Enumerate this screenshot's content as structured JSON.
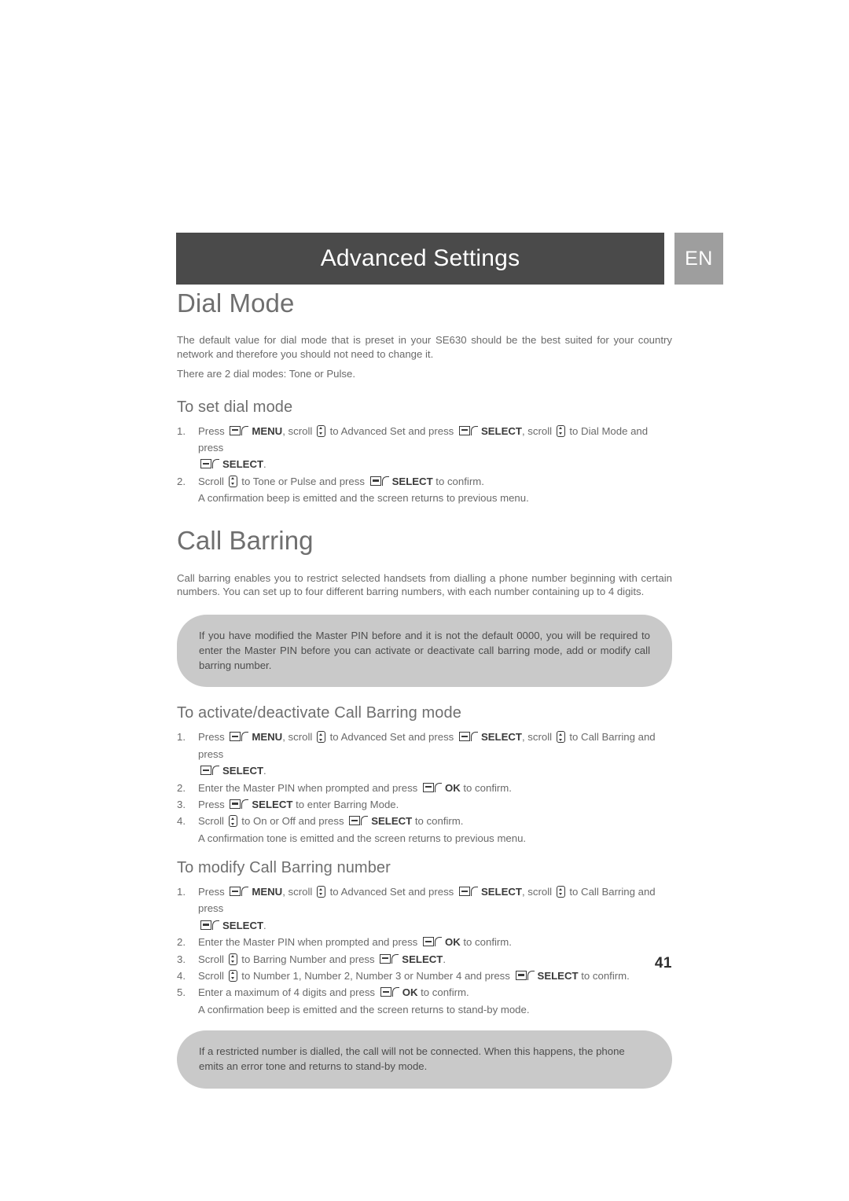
{
  "header": {
    "title": "Advanced Settings",
    "language_badge": "EN"
  },
  "sections": [
    {
      "title": "Dial Mode",
      "paragraphs": [
        "The default value for dial mode that is preset in your SE630 should be the best suited for your country network and therefore you should not need to change it.",
        "There are 2 dial modes: Tone or Pulse."
      ],
      "subsections": [
        {
          "title": "To set dial mode",
          "steps": [
            {
              "num": "1.",
              "parts": [
                {
                  "t": "text",
                  "v": "Press "
                },
                {
                  "t": "softkey-icon"
                },
                {
                  "t": "bold",
                  "v": "MENU"
                },
                {
                  "t": "text",
                  "v": ", scroll "
                },
                {
                  "t": "scroll-icon"
                },
                {
                  "t": "text",
                  "v": " to Advanced Set and press "
                },
                {
                  "t": "softkey-icon"
                },
                {
                  "t": "bold",
                  "v": "SELECT"
                },
                {
                  "t": "text",
                  "v": ", scroll "
                },
                {
                  "t": "scroll-icon"
                },
                {
                  "t": "text",
                  "v": " to Dial Mode and press "
                },
                {
                  "t": "break"
                },
                {
                  "t": "softkey-icon"
                },
                {
                  "t": "bold",
                  "v": "SELECT"
                },
                {
                  "t": "text",
                  "v": "."
                }
              ],
              "sub": null
            },
            {
              "num": "2.",
              "parts": [
                {
                  "t": "text",
                  "v": "Scroll "
                },
                {
                  "t": "scroll-icon"
                },
                {
                  "t": "text",
                  "v": " to Tone or Pulse and press "
                },
                {
                  "t": "softkey-icon"
                },
                {
                  "t": "bold",
                  "v": "SELECT"
                },
                {
                  "t": "text",
                  "v": " to confirm."
                }
              ],
              "sub": "A confirmation beep is emitted and the screen returns to previous menu."
            }
          ]
        }
      ]
    },
    {
      "title": "Call Barring",
      "paragraphs": [
        "Call barring enables you to restrict selected handsets from dialling a phone number beginning with certain numbers. You can set up to four different barring numbers, with each number containing up to 4 digits."
      ],
      "note": {
        "lines": [
          "If you have modified the Master PIN before and it is not the default 0000, you will be required to enter the Master PIN before you can activate or deactivate call barring mode, add or modify call barring number."
        ]
      },
      "subsections": [
        {
          "title": "To activate/deactivate Call Barring mode",
          "steps": [
            {
              "num": "1.",
              "parts": [
                {
                  "t": "text",
                  "v": "Press "
                },
                {
                  "t": "softkey-icon"
                },
                {
                  "t": "bold",
                  "v": "MENU"
                },
                {
                  "t": "text",
                  "v": ", scroll "
                },
                {
                  "t": "scroll-icon"
                },
                {
                  "t": "text",
                  "v": " to Advanced Set and press "
                },
                {
                  "t": "softkey-icon"
                },
                {
                  "t": "bold",
                  "v": "SELECT"
                },
                {
                  "t": "text",
                  "v": ", scroll "
                },
                {
                  "t": "scroll-icon"
                },
                {
                  "t": "text",
                  "v": " to Call Barring and press "
                },
                {
                  "t": "break"
                },
                {
                  "t": "softkey-icon"
                },
                {
                  "t": "bold",
                  "v": "SELECT"
                },
                {
                  "t": "text",
                  "v": "."
                }
              ],
              "sub": null
            },
            {
              "num": "2.",
              "parts": [
                {
                  "t": "text",
                  "v": "Enter the Master PIN when prompted and press "
                },
                {
                  "t": "softkey-icon"
                },
                {
                  "t": "bold",
                  "v": "OK"
                },
                {
                  "t": "text",
                  "v": " to confirm."
                }
              ],
              "sub": null
            },
            {
              "num": "3.",
              "parts": [
                {
                  "t": "text",
                  "v": "Press "
                },
                {
                  "t": "softkey-icon"
                },
                {
                  "t": "bold",
                  "v": "SELECT"
                },
                {
                  "t": "text",
                  "v": " to enter Barring Mode."
                }
              ],
              "sub": null
            },
            {
              "num": "4.",
              "parts": [
                {
                  "t": "text",
                  "v": "Scroll "
                },
                {
                  "t": "scroll-icon"
                },
                {
                  "t": "text",
                  "v": " to On or Off and press "
                },
                {
                  "t": "softkey-icon"
                },
                {
                  "t": "bold",
                  "v": "SELECT"
                },
                {
                  "t": "text",
                  "v": " to confirm."
                }
              ],
              "sub": "A confirmation tone is emitted and the screen returns to previous menu."
            }
          ]
        },
        {
          "title": "To modify Call Barring number",
          "steps": [
            {
              "num": "1.",
              "parts": [
                {
                  "t": "text",
                  "v": "Press "
                },
                {
                  "t": "softkey-icon"
                },
                {
                  "t": "bold",
                  "v": "MENU"
                },
                {
                  "t": "text",
                  "v": ", scroll "
                },
                {
                  "t": "scroll-icon"
                },
                {
                  "t": "text",
                  "v": " to Advanced Set and press "
                },
                {
                  "t": "softkey-icon"
                },
                {
                  "t": "bold",
                  "v": "SELECT"
                },
                {
                  "t": "text",
                  "v": ", scroll "
                },
                {
                  "t": "scroll-icon"
                },
                {
                  "t": "text",
                  "v": " to Call Barring and press "
                },
                {
                  "t": "break"
                },
                {
                  "t": "softkey-icon"
                },
                {
                  "t": "bold",
                  "v": "SELECT"
                },
                {
                  "t": "text",
                  "v": "."
                }
              ],
              "sub": null
            },
            {
              "num": "2.",
              "parts": [
                {
                  "t": "text",
                  "v": "Enter the Master PIN when prompted and press "
                },
                {
                  "t": "softkey-icon"
                },
                {
                  "t": "bold",
                  "v": "OK"
                },
                {
                  "t": "text",
                  "v": " to confirm."
                }
              ],
              "sub": null
            },
            {
              "num": "3.",
              "parts": [
                {
                  "t": "text",
                  "v": "Scroll "
                },
                {
                  "t": "scroll-icon"
                },
                {
                  "t": "text",
                  "v": " to Barring Number and press "
                },
                {
                  "t": "softkey-icon"
                },
                {
                  "t": "bold",
                  "v": "SELECT"
                },
                {
                  "t": "text",
                  "v": "."
                }
              ],
              "sub": null
            },
            {
              "num": "4.",
              "parts": [
                {
                  "t": "text",
                  "v": "Scroll "
                },
                {
                  "t": "scroll-icon"
                },
                {
                  "t": "text",
                  "v": " to Number 1, Number 2, Number 3 or Number 4 and press "
                },
                {
                  "t": "softkey-icon"
                },
                {
                  "t": "bold",
                  "v": "SELECT"
                },
                {
                  "t": "text",
                  "v": " to confirm."
                }
              ],
              "sub": null
            },
            {
              "num": "5.",
              "parts": [
                {
                  "t": "text",
                  "v": "Enter a maximum of 4 digits and press "
                },
                {
                  "t": "softkey-icon"
                },
                {
                  "t": "bold",
                  "v": "OK"
                },
                {
                  "t": "text",
                  "v": " to confirm."
                }
              ],
              "sub": "A confirmation beep is emitted and the screen returns to stand-by mode."
            }
          ]
        }
      ],
      "note_bottom": {
        "lines": [
          "If a restricted number is dialled, the call will not be connected. When this happens, the phone emits an error tone and returns to stand-by mode."
        ]
      }
    }
  ],
  "page_number": "41",
  "colors": {
    "header_bar": "#4a4a4a",
    "lang_badge": "#9e9e9e",
    "heading": "#6f6f6f",
    "body": "#6a6a6a",
    "note_bg": "#c9c9c9"
  }
}
